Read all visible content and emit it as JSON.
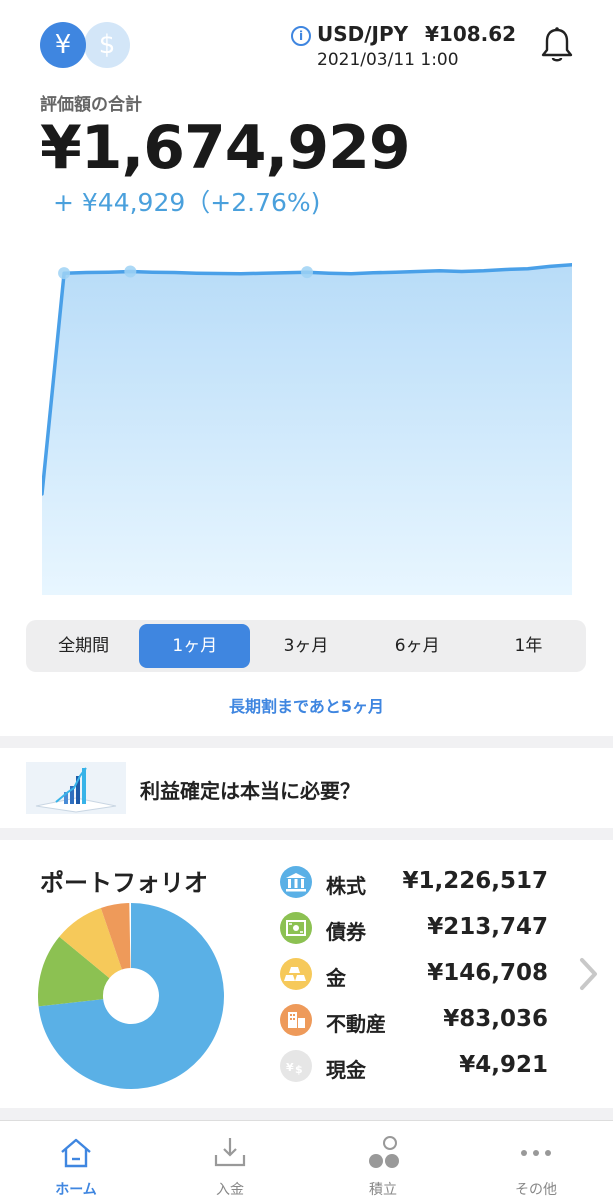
{
  "header": {
    "currency_yen_icon": "yen-icon",
    "currency_usd_icon": "dollar-icon",
    "fx_pair": "USD/JPY",
    "fx_rate": "¥108.62",
    "fx_time": "2021/03/11 1:00"
  },
  "summary": {
    "label": "評価額の合計",
    "total": "¥1,674,929",
    "change": "+ ¥44,929（+2.76%)"
  },
  "chart_data": {
    "type": "area",
    "values": [
      0.3,
      0.955,
      0.957,
      0.958,
      0.96,
      0.958,
      0.957,
      0.955,
      0.954,
      0.953,
      0.955,
      0.956,
      0.958,
      0.955,
      0.953,
      0.956,
      0.958,
      0.96,
      0.962,
      0.96,
      0.962,
      0.966,
      0.968,
      0.975,
      0.98
    ],
    "line_color": "#4aa0e8",
    "fill_top_color": "#b8dcf8",
    "fill_bottom_color": "#e8f6ff",
    "markers_at": [
      1,
      4,
      12
    ]
  },
  "periods": {
    "items": [
      "全期間",
      "1ヶ月",
      "3ヶ月",
      "6ヶ月",
      "1年"
    ],
    "selected": "1ヶ月"
  },
  "long_term_note": "長期割まであと5ヶ月",
  "banner": {
    "text": "利益確定は本当に必要？"
  },
  "portfolio": {
    "title": "ポートフォリオ",
    "items": [
      {
        "name": "株式",
        "value": "¥1,226,517",
        "amount": 1226517,
        "color": "#5ab0e6",
        "icon": "bank-icon"
      },
      {
        "name": "債券",
        "value": "¥213,747",
        "amount": 213747,
        "color": "#8cc152",
        "icon": "bond-icon"
      },
      {
        "name": "金",
        "value": "¥146,708",
        "amount": 146708,
        "color": "#f6c95a",
        "icon": "gold-icon"
      },
      {
        "name": "不動産",
        "value": "¥83,036",
        "amount": 83036,
        "color": "#ee9a5a",
        "icon": "building-icon"
      },
      {
        "name": "現金",
        "value": "¥4,921",
        "amount": 4921,
        "color": "#e6e6e6",
        "icon": "cash-icon"
      }
    ]
  },
  "tabbar": {
    "items": [
      {
        "label": "ホーム",
        "icon": "home-icon",
        "active": true
      },
      {
        "label": "入金",
        "icon": "deposit-icon",
        "active": false
      },
      {
        "label": "積立",
        "icon": "savings-icon",
        "active": false
      },
      {
        "label": "その他",
        "icon": "more-icon",
        "active": false
      }
    ]
  }
}
